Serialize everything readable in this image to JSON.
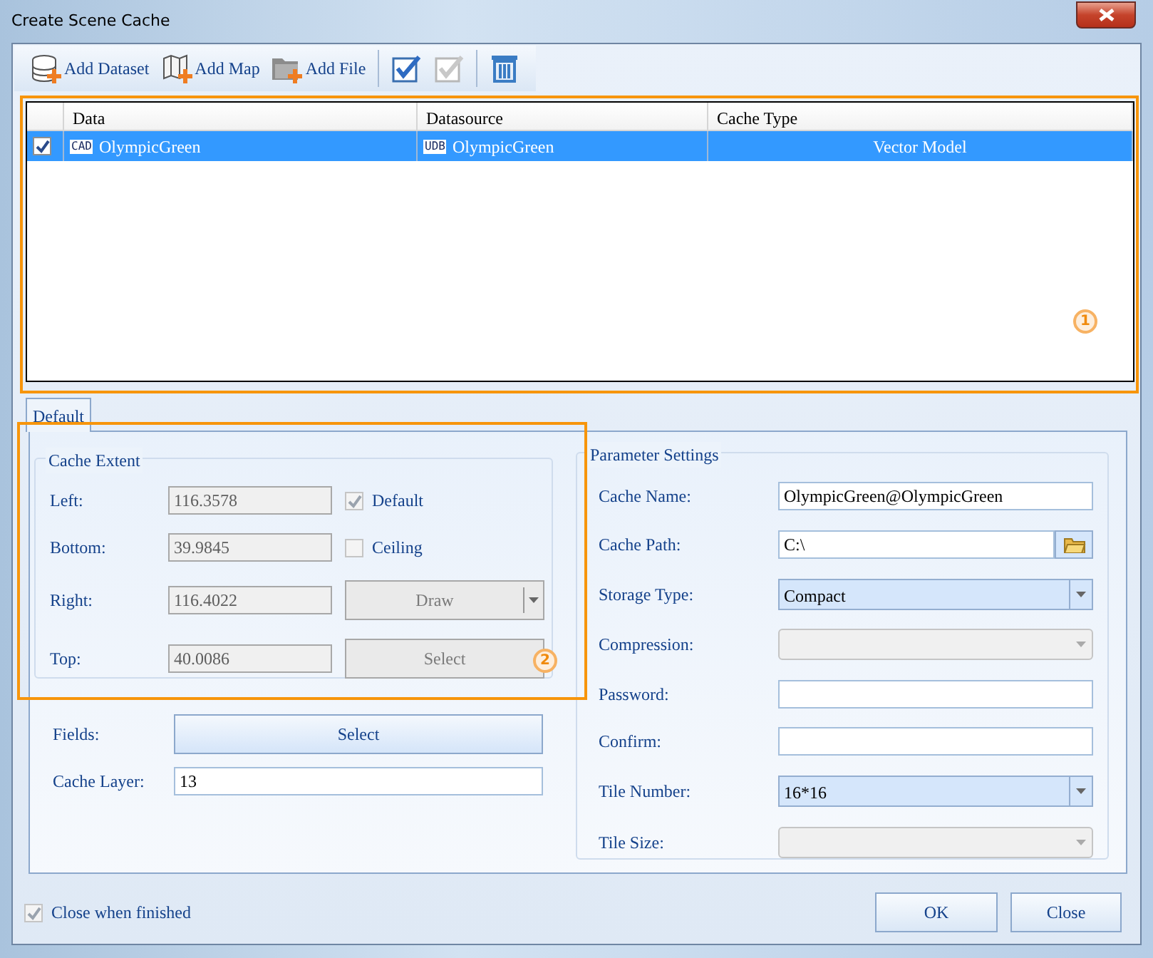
{
  "window": {
    "title": "Create Scene Cache"
  },
  "toolbar": [
    {
      "kind": "dataset",
      "label": "Add Dataset"
    },
    {
      "kind": "map",
      "label": "Add Map"
    },
    {
      "kind": "file",
      "label": "Add File"
    },
    {
      "kind": "check-all"
    },
    {
      "kind": "uncheck"
    },
    {
      "kind": "delete"
    }
  ],
  "table": {
    "columns": [
      "Data",
      "Datasource",
      "Cache Type"
    ],
    "rows": [
      {
        "checked": true,
        "selected": true,
        "data_badge": "CAD",
        "data": "OlympicGreen",
        "datasource_badge": "UDB",
        "datasource": "OlympicGreen",
        "cache_type": "Vector Model"
      }
    ]
  },
  "annotations": [
    {
      "label": "1"
    },
    {
      "label": "2"
    }
  ],
  "tabs": [
    {
      "label": "Default",
      "selected": true
    }
  ],
  "cache_extent": {
    "title": "Cache Extent",
    "rows": [
      {
        "label": "Left:",
        "value": "116.3578",
        "disabled": true,
        "option": {
          "kind": "checkbox",
          "label": "Default",
          "checked": true,
          "disabled": true
        }
      },
      {
        "label": "Bottom:",
        "value": "39.9845",
        "disabled": true,
        "option": {
          "kind": "checkbox",
          "label": "Ceiling",
          "checked": false,
          "disabled": true
        }
      },
      {
        "label": "Right:",
        "value": "116.4022",
        "disabled": true,
        "option": {
          "kind": "split-button",
          "label": "Draw",
          "disabled": true
        }
      },
      {
        "label": "Top:",
        "value": "40.0086",
        "disabled": true,
        "option": {
          "kind": "button",
          "label": "Select",
          "disabled": true
        }
      }
    ]
  },
  "fields": {
    "label": "Fields:",
    "button": "Select"
  },
  "cache_layer": {
    "label": "Cache Layer:",
    "value": "13"
  },
  "parameter_settings": {
    "title": "Parameter Settings",
    "rows": [
      {
        "kind": "text",
        "label": "Cache Name:",
        "value": "OlympicGreen@OlympicGreen"
      },
      {
        "kind": "path",
        "label": "Cache Path:",
        "value": "C:\\"
      },
      {
        "kind": "select",
        "label": "Storage Type:",
        "value": "Compact",
        "disabled": false
      },
      {
        "kind": "select",
        "label": "Compression:",
        "disabled": true
      },
      {
        "kind": "text",
        "label": "Password:"
      },
      {
        "kind": "text",
        "label": "Confirm:"
      },
      {
        "kind": "select",
        "label": "Tile Number:",
        "value": "16*16",
        "disabled": false
      },
      {
        "kind": "select",
        "label": "Tile Size:",
        "disabled": true
      }
    ]
  },
  "close_when_finished": {
    "label": "Close when finished",
    "checked": true,
    "disabled": true
  },
  "buttons": [
    "OK",
    "Close"
  ]
}
